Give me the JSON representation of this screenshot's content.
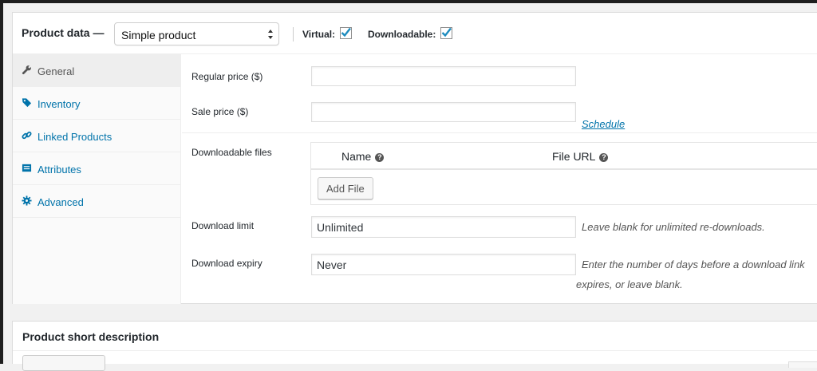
{
  "header": {
    "title": "Product data —",
    "product_type": "Simple product",
    "virtual_label": "Virtual:",
    "virtual_checked": true,
    "downloadable_label": "Downloadable:",
    "downloadable_checked": true
  },
  "tabs": [
    {
      "label": "General",
      "icon": "wrench-icon",
      "active": true
    },
    {
      "label": "Inventory",
      "icon": "tag-icon",
      "active": false
    },
    {
      "label": "Linked Products",
      "icon": "link-icon",
      "active": false
    },
    {
      "label": "Attributes",
      "icon": "list-icon",
      "active": false
    },
    {
      "label": "Advanced",
      "icon": "gear-icon",
      "active": false
    }
  ],
  "general": {
    "regular_price_label": "Regular price ($)",
    "regular_price_value": "",
    "sale_price_label": "Sale price ($)",
    "sale_price_value": "",
    "schedule_link": "Schedule",
    "downloadable_files_label": "Downloadable files",
    "files_table": {
      "col_name": "Name",
      "col_url": "File URL",
      "add_file_button": "Add File"
    },
    "download_limit_label": "Download limit",
    "download_limit_value": "Unlimited",
    "download_limit_desc": "Leave blank for unlimited re-downloads.",
    "download_expiry_label": "Download expiry",
    "download_expiry_value": "Never",
    "download_expiry_desc_line1": "Enter the number of days before a download link",
    "download_expiry_desc_line2": "expires, or leave blank."
  },
  "short_description": {
    "title": "Product short description"
  },
  "colors": {
    "link": "#0073aa",
    "checkmark": "#1e8cbe",
    "active_tab_bg": "#eeeeee"
  }
}
